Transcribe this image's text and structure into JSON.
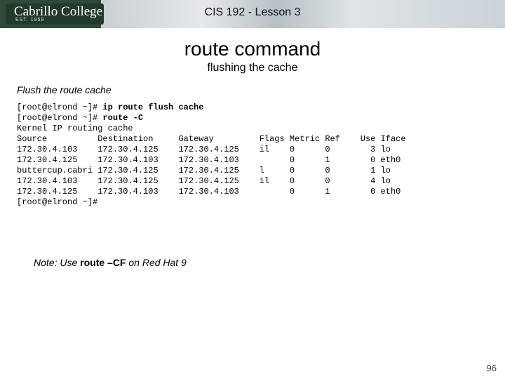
{
  "banner": {
    "logo_text": "Cabrillo College",
    "logo_est": "EST. 1959",
    "title": "CIS 192 - Lesson 3"
  },
  "headings": {
    "h1": "route command",
    "h2": "flushing the cache",
    "subhead": "Flush the route cache"
  },
  "terminal": {
    "prompt1": "[root@elrond ~]# ",
    "cmd1": "ip route flush cache",
    "prompt2": "[root@elrond ~]# ",
    "cmd2": "route -C",
    "line_kernel": "Kernel IP routing cache",
    "hdr_source": "Source",
    "hdr_dest": "Destination",
    "hdr_gateway": "Gateway",
    "hdr_flags": "Flags",
    "hdr_metric": "Metric",
    "hdr_ref": "Ref",
    "hdr_use": "Use",
    "hdr_iface": "Iface",
    "rows": [
      {
        "src": "172.30.4.103",
        "dst": "172.30.4.125",
        "gw": "172.30.4.125",
        "flags": "il",
        "metric": "0",
        "ref": "0",
        "use": "3",
        "iface": "lo"
      },
      {
        "src": "172.30.4.125",
        "dst": "172.30.4.103",
        "gw": "172.30.4.103",
        "flags": "",
        "metric": "0",
        "ref": "1",
        "use": "0",
        "iface": "eth0"
      },
      {
        "src": "buttercup.cabri",
        "dst": "172.30.4.125",
        "gw": "172.30.4.125",
        "flags": "l",
        "metric": "0",
        "ref": "0",
        "use": "1",
        "iface": "lo"
      },
      {
        "src": "172.30.4.103",
        "dst": "172.30.4.125",
        "gw": "172.30.4.125",
        "flags": "il",
        "metric": "0",
        "ref": "0",
        "use": "4",
        "iface": "lo"
      },
      {
        "src": "172.30.4.125",
        "dst": "172.30.4.103",
        "gw": "172.30.4.103",
        "flags": "",
        "metric": "0",
        "ref": "1",
        "use": "0",
        "iface": "eth0"
      }
    ],
    "prompt3": "[root@elrond ~]#"
  },
  "note": {
    "lead": "Note: Use ",
    "bold": "route –CF",
    "tail": " on Red Hat 9"
  },
  "page_number": "96"
}
